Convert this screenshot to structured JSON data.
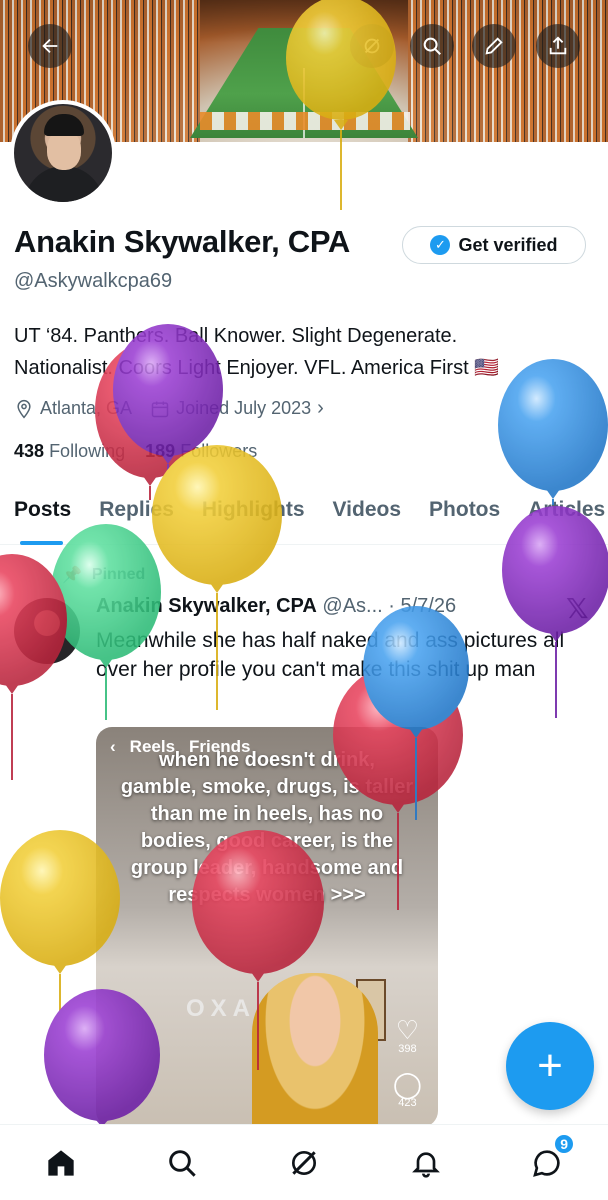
{
  "profile": {
    "name": "Anakin Skywalker, CPA",
    "verify_label": "Get verified",
    "handle": "@Askywalkcpa69",
    "bio": "UT ‘84. Panthers. Ball Knower. Slight Degenerate.\nNationalist. Coors Light Enjoyer. VFL. America First 🇺🇸",
    "location": "Atlanta, GA",
    "joined": "Joined July 2023",
    "following_count": "438",
    "following_label": "Following",
    "followers_count": "189",
    "followers_label": "Followers"
  },
  "tabs": [
    "Posts",
    "Replies",
    "Highlights",
    "Videos",
    "Photos",
    "Articles"
  ],
  "post": {
    "pinned_label": "Pinned",
    "author": "Anakin Skywalker, CPA",
    "handle": "@As...",
    "date": "5/7/26",
    "text": "Meanwhile she has half naked and ass pictures all over her profile you can't make this shit up man",
    "media": {
      "top_left": "Reels",
      "top_right": "Friends",
      "caption": "when he doesn't drink,\ngamble, smoke, drugs, is taller\nthan me in heels, has no\nbodies, good career, is the\ngroup leader, handsome and\nrespects women >>>",
      "wall_text": "OXA",
      "likes": "398",
      "comments": "423"
    }
  },
  "nav": {
    "icons": [
      "home-icon",
      "search-icon",
      "grok-icon",
      "bell-icon",
      "messages-icon"
    ],
    "messages_badge": "9"
  },
  "colors": {
    "accent": "#1d9bf0",
    "balloon_yellow": "#f2cf3a",
    "balloon_purple": "#9b3fd3",
    "balloon_red": "#e9455f",
    "balloon_blue": "#4aa3f0",
    "balloon_green": "#5fe0a0"
  }
}
